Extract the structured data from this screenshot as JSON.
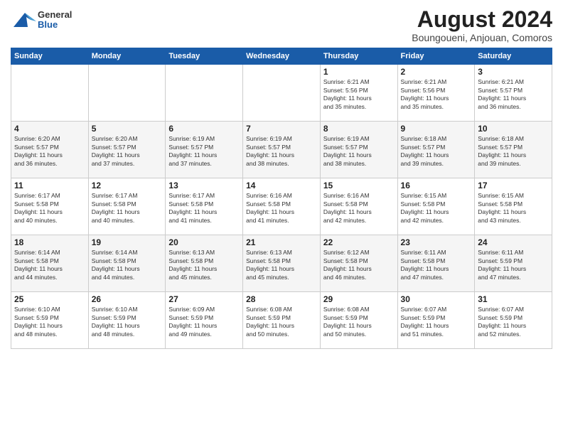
{
  "header": {
    "logo_general": "General",
    "logo_blue": "Blue",
    "title": "August 2024",
    "location": "Boungoueni, Anjouan, Comoros"
  },
  "days_of_week": [
    "Sunday",
    "Monday",
    "Tuesday",
    "Wednesday",
    "Thursday",
    "Friday",
    "Saturday"
  ],
  "weeks": [
    [
      {
        "day": "",
        "info": ""
      },
      {
        "day": "",
        "info": ""
      },
      {
        "day": "",
        "info": ""
      },
      {
        "day": "",
        "info": ""
      },
      {
        "day": "1",
        "info": "Sunrise: 6:21 AM\nSunset: 5:56 PM\nDaylight: 11 hours\nand 35 minutes."
      },
      {
        "day": "2",
        "info": "Sunrise: 6:21 AM\nSunset: 5:56 PM\nDaylight: 11 hours\nand 35 minutes."
      },
      {
        "day": "3",
        "info": "Sunrise: 6:21 AM\nSunset: 5:57 PM\nDaylight: 11 hours\nand 36 minutes."
      }
    ],
    [
      {
        "day": "4",
        "info": "Sunrise: 6:20 AM\nSunset: 5:57 PM\nDaylight: 11 hours\nand 36 minutes."
      },
      {
        "day": "5",
        "info": "Sunrise: 6:20 AM\nSunset: 5:57 PM\nDaylight: 11 hours\nand 37 minutes."
      },
      {
        "day": "6",
        "info": "Sunrise: 6:19 AM\nSunset: 5:57 PM\nDaylight: 11 hours\nand 37 minutes."
      },
      {
        "day": "7",
        "info": "Sunrise: 6:19 AM\nSunset: 5:57 PM\nDaylight: 11 hours\nand 38 minutes."
      },
      {
        "day": "8",
        "info": "Sunrise: 6:19 AM\nSunset: 5:57 PM\nDaylight: 11 hours\nand 38 minutes."
      },
      {
        "day": "9",
        "info": "Sunrise: 6:18 AM\nSunset: 5:57 PM\nDaylight: 11 hours\nand 39 minutes."
      },
      {
        "day": "10",
        "info": "Sunrise: 6:18 AM\nSunset: 5:57 PM\nDaylight: 11 hours\nand 39 minutes."
      }
    ],
    [
      {
        "day": "11",
        "info": "Sunrise: 6:17 AM\nSunset: 5:58 PM\nDaylight: 11 hours\nand 40 minutes."
      },
      {
        "day": "12",
        "info": "Sunrise: 6:17 AM\nSunset: 5:58 PM\nDaylight: 11 hours\nand 40 minutes."
      },
      {
        "day": "13",
        "info": "Sunrise: 6:17 AM\nSunset: 5:58 PM\nDaylight: 11 hours\nand 41 minutes."
      },
      {
        "day": "14",
        "info": "Sunrise: 6:16 AM\nSunset: 5:58 PM\nDaylight: 11 hours\nand 41 minutes."
      },
      {
        "day": "15",
        "info": "Sunrise: 6:16 AM\nSunset: 5:58 PM\nDaylight: 11 hours\nand 42 minutes."
      },
      {
        "day": "16",
        "info": "Sunrise: 6:15 AM\nSunset: 5:58 PM\nDaylight: 11 hours\nand 42 minutes."
      },
      {
        "day": "17",
        "info": "Sunrise: 6:15 AM\nSunset: 5:58 PM\nDaylight: 11 hours\nand 43 minutes."
      }
    ],
    [
      {
        "day": "18",
        "info": "Sunrise: 6:14 AM\nSunset: 5:58 PM\nDaylight: 11 hours\nand 44 minutes."
      },
      {
        "day": "19",
        "info": "Sunrise: 6:14 AM\nSunset: 5:58 PM\nDaylight: 11 hours\nand 44 minutes."
      },
      {
        "day": "20",
        "info": "Sunrise: 6:13 AM\nSunset: 5:58 PM\nDaylight: 11 hours\nand 45 minutes."
      },
      {
        "day": "21",
        "info": "Sunrise: 6:13 AM\nSunset: 5:58 PM\nDaylight: 11 hours\nand 45 minutes."
      },
      {
        "day": "22",
        "info": "Sunrise: 6:12 AM\nSunset: 5:58 PM\nDaylight: 11 hours\nand 46 minutes."
      },
      {
        "day": "23",
        "info": "Sunrise: 6:11 AM\nSunset: 5:58 PM\nDaylight: 11 hours\nand 47 minutes."
      },
      {
        "day": "24",
        "info": "Sunrise: 6:11 AM\nSunset: 5:59 PM\nDaylight: 11 hours\nand 47 minutes."
      }
    ],
    [
      {
        "day": "25",
        "info": "Sunrise: 6:10 AM\nSunset: 5:59 PM\nDaylight: 11 hours\nand 48 minutes."
      },
      {
        "day": "26",
        "info": "Sunrise: 6:10 AM\nSunset: 5:59 PM\nDaylight: 11 hours\nand 48 minutes."
      },
      {
        "day": "27",
        "info": "Sunrise: 6:09 AM\nSunset: 5:59 PM\nDaylight: 11 hours\nand 49 minutes."
      },
      {
        "day": "28",
        "info": "Sunrise: 6:08 AM\nSunset: 5:59 PM\nDaylight: 11 hours\nand 50 minutes."
      },
      {
        "day": "29",
        "info": "Sunrise: 6:08 AM\nSunset: 5:59 PM\nDaylight: 11 hours\nand 50 minutes."
      },
      {
        "day": "30",
        "info": "Sunrise: 6:07 AM\nSunset: 5:59 PM\nDaylight: 11 hours\nand 51 minutes."
      },
      {
        "day": "31",
        "info": "Sunrise: 6:07 AM\nSunset: 5:59 PM\nDaylight: 11 hours\nand 52 minutes."
      }
    ]
  ]
}
